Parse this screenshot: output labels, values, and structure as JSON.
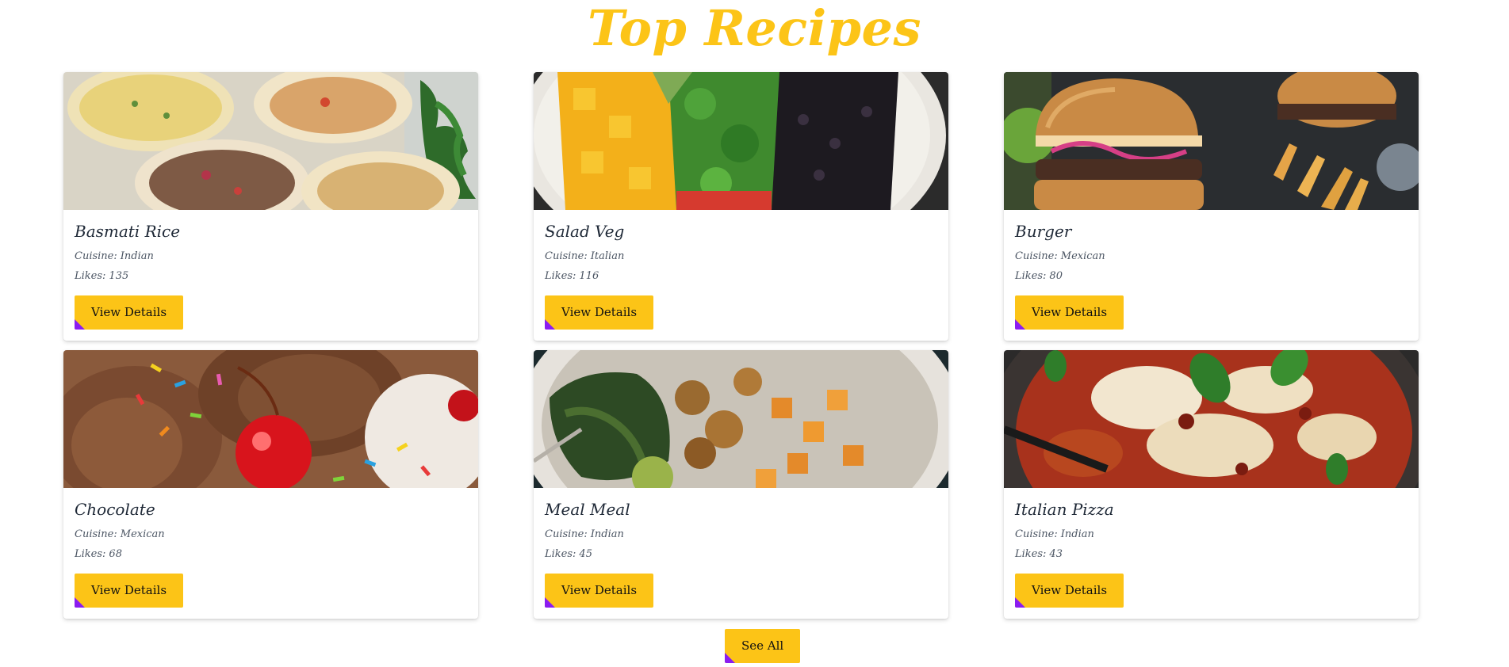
{
  "page": {
    "title": "Top Recipes",
    "see_all_label": "See All",
    "accent_color": "#fcc417",
    "corner_color": "#8b1df0"
  },
  "recipes": [
    {
      "name": "Basmati Rice",
      "cuisine_label": "Cuisine:",
      "cuisine": "Indian",
      "likes_label": "Likes:",
      "likes": "135",
      "button_label": "View Details",
      "image": "wraps-photo"
    },
    {
      "name": "Salad Veg",
      "cuisine_label": "Cuisine:",
      "cuisine": "Italian",
      "likes_label": "Likes:",
      "likes": "116",
      "button_label": "View Details",
      "image": "salad-bowl-photo"
    },
    {
      "name": "Burger",
      "cuisine_label": "Cuisine:",
      "cuisine": "Mexican",
      "likes_label": "Likes:",
      "likes": "80",
      "button_label": "View Details",
      "image": "burger-photo"
    },
    {
      "name": "Chocolate",
      "cuisine_label": "Cuisine:",
      "cuisine": "Mexican",
      "likes_label": "Likes:",
      "likes": "68",
      "button_label": "View Details",
      "image": "ice-cream-photo"
    },
    {
      "name": "Meal Meal",
      "cuisine_label": "Cuisine:",
      "cuisine": "Indian",
      "likes_label": "Likes:",
      "likes": "45",
      "button_label": "View Details",
      "image": "meal-bowl-photo"
    },
    {
      "name": "Italian Pizza",
      "cuisine_label": "Cuisine:",
      "cuisine": "Indian",
      "likes_label": "Likes:",
      "likes": "43",
      "button_label": "View Details",
      "image": "pizza-photo"
    }
  ]
}
